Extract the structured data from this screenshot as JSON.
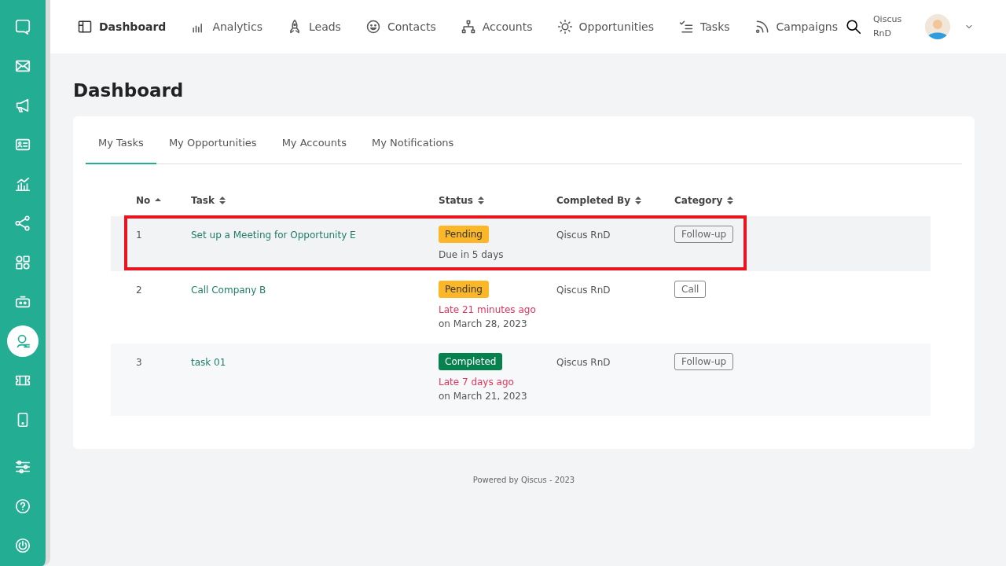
{
  "sidebar": {
    "items": [
      {
        "selected": false
      },
      {
        "selected": false
      },
      {
        "selected": false
      },
      {
        "selected": false
      },
      {
        "selected": false
      },
      {
        "selected": false
      },
      {
        "selected": false
      },
      {
        "selected": false
      },
      {
        "selected": true
      },
      {
        "selected": false
      },
      {
        "selected": false
      },
      {
        "selected": false
      },
      {
        "selected": false
      },
      {
        "selected": false
      }
    ]
  },
  "nav": {
    "items": [
      {
        "label": "Dashboard",
        "selected": true
      },
      {
        "label": "Analytics",
        "selected": false
      },
      {
        "label": "Leads",
        "selected": false
      },
      {
        "label": "Contacts",
        "selected": false
      },
      {
        "label": "Accounts",
        "selected": false
      },
      {
        "label": "Opportunities",
        "selected": false
      },
      {
        "label": "Tasks",
        "selected": false
      },
      {
        "label": "Campaigns",
        "selected": false
      }
    ],
    "user": {
      "first": "Qiscus",
      "second": "RnD"
    }
  },
  "page_title": "Dashboard",
  "tabs": [
    {
      "label": "My Tasks",
      "selected": true
    },
    {
      "label": "My Opportunities",
      "selected": false
    },
    {
      "label": "My Accounts",
      "selected": false
    },
    {
      "label": "My Notifications",
      "selected": false
    }
  ],
  "table": {
    "columns": [
      {
        "label": "No",
        "sorted": true
      },
      {
        "label": "Task",
        "sorted": false
      },
      {
        "label": "Status",
        "sorted": false
      },
      {
        "label": "Completed By",
        "sorted": false
      },
      {
        "label": "Category",
        "sorted": false
      }
    ],
    "rows": [
      {
        "no": "1",
        "task": "Set up a Meeting for Opportunity E",
        "status": {
          "label": "Pending",
          "kind": "pending"
        },
        "notes": [
          {
            "text": "Due in 5 days",
            "kind": "normal"
          }
        ],
        "completed_by": "Qiscus RnD",
        "category": "Follow-up",
        "highlighted": true
      },
      {
        "no": "2",
        "task": "Call Company B",
        "status": {
          "label": "Pending",
          "kind": "pending"
        },
        "notes": [
          {
            "text": "Late 21 minutes ago",
            "kind": "late"
          },
          {
            "text": "on March 28, 2023",
            "kind": "normal"
          }
        ],
        "completed_by": "Qiscus RnD",
        "category": "Call",
        "highlighted": false
      },
      {
        "no": "3",
        "task": "task 01",
        "status": {
          "label": "Completed",
          "kind": "completed"
        },
        "notes": [
          {
            "text": "Late 7 days ago",
            "kind": "late"
          },
          {
            "text": "on March 21, 2023",
            "kind": "normal"
          }
        ],
        "completed_by": "Qiscus RnD",
        "category": "Follow-up",
        "highlighted": false
      }
    ]
  },
  "footer": "Powered by Qiscus - 2023"
}
